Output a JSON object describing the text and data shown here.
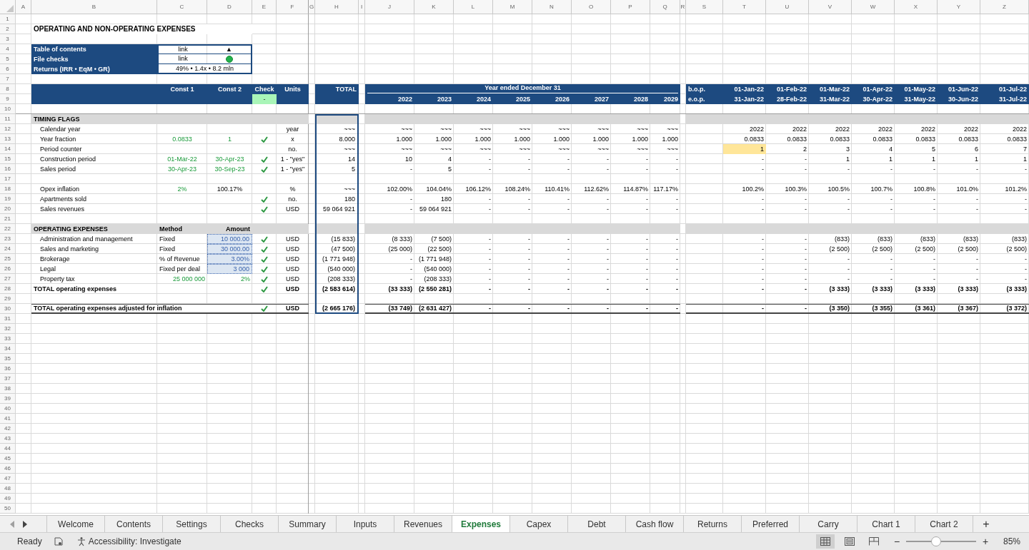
{
  "columns": [
    "A",
    "B",
    "C",
    "D",
    "E",
    "F",
    "G",
    "H",
    "I",
    "J",
    "K",
    "L",
    "M",
    "N",
    "O",
    "P",
    "Q",
    "R",
    "S",
    "T",
    "U",
    "V",
    "W",
    "X",
    "Y",
    "Z"
  ],
  "sheet": {
    "rows": [
      {
        "number": "1",
        "kind": "blank"
      },
      {
        "number": "2",
        "kind": "title",
        "label": "OPERATING AND NON-OPERATING EXPENSES"
      },
      {
        "number": "3",
        "kind": "blank"
      },
      {
        "number": "4",
        "kind": "nav",
        "label": "Table of contents",
        "col_c": {
          "text": "link",
          "kind": "link"
        },
        "col_d": {
          "text": "▲",
          "kind": "glyph"
        }
      },
      {
        "number": "5",
        "kind": "nav",
        "label": "File checks",
        "col_c": {
          "text": "link",
          "kind": "link"
        },
        "col_d": {
          "kind": "status-dot",
          "ok": true
        }
      },
      {
        "number": "6",
        "kind": "nav",
        "label": "Returns (IRR • EqM • GR)",
        "col_c": {
          "text": "49% • 1.4x • 8.2 mln",
          "kind": "plain",
          "merged": true
        }
      },
      {
        "number": "7",
        "kind": "blank"
      },
      {
        "number": "8",
        "kind": "header",
        "col_c": {
          "text": "Const 1",
          "kind": "heading"
        },
        "col_d": {
          "text": "Const 2",
          "kind": "heading"
        },
        "check": {
          "kind": "heading",
          "text": "Check"
        },
        "units": "Units",
        "total": "TOTAL",
        "years_title": "Year ended December 31",
        "period": "b.o.p.",
        "months": [
          "01-Jan-22",
          "01-Feb-22",
          "01-Mar-22",
          "01-Apr-22",
          "01-May-22",
          "01-Jun-22",
          "01-Jul-22"
        ]
      },
      {
        "number": "9",
        "kind": "header",
        "check": {
          "kind": "badge",
          "text": "-"
        },
        "years": [
          "2022",
          "2023",
          "2024",
          "2025",
          "2026",
          "2027",
          "2028",
          "2029"
        ],
        "period": "e.o.p.",
        "months": [
          "31-Jan-22",
          "28-Feb-22",
          "31-Mar-22",
          "30-Apr-22",
          "31-May-22",
          "30-Jun-22",
          "31-Jul-22"
        ]
      },
      {
        "number": "10",
        "kind": "blank"
      },
      {
        "number": "11",
        "kind": "section",
        "label": "TIMING FLAGS"
      },
      {
        "number": "12",
        "kind": "data",
        "label": "Calendar year",
        "units": "year",
        "total": "~~~",
        "years": [
          "~~~",
          "~~~",
          "~~~",
          "~~~",
          "~~~",
          "~~~",
          "~~~",
          "~~~"
        ],
        "months": [
          "2022",
          "2022",
          "2022",
          "2022",
          "2022",
          "2022",
          "2022"
        ]
      },
      {
        "number": "13",
        "kind": "data",
        "label": "Year fraction",
        "col_c": {
          "text": "0.0833",
          "kind": "input"
        },
        "col_d": {
          "text": "1",
          "kind": "input"
        },
        "check": {
          "kind": "tick",
          "ok": true
        },
        "units": "x",
        "total": "8.000",
        "years": [
          "1.000",
          "1.000",
          "1.000",
          "1.000",
          "1.000",
          "1.000",
          "1.000",
          "1.000"
        ],
        "months": [
          "0.0833",
          "0.0833",
          "0.0833",
          "0.0833",
          "0.0833",
          "0.0833",
          "0.0833"
        ]
      },
      {
        "number": "14",
        "kind": "data",
        "label": "Period counter",
        "units": "no.",
        "total": "~~~",
        "years": [
          "~~~",
          "~~~",
          "~~~",
          "~~~",
          "~~~",
          "~~~",
          "~~~",
          "~~~"
        ],
        "months": [
          {
            "text": "1",
            "highlighted": true
          },
          {
            "text": "2",
            "highlighted": false
          },
          {
            "text": "3",
            "highlighted": false
          },
          {
            "text": "4",
            "highlighted": false
          },
          {
            "text": "5",
            "highlighted": false
          },
          {
            "text": "6",
            "highlighted": false
          },
          {
            "text": "7",
            "highlighted": false
          }
        ]
      },
      {
        "number": "15",
        "kind": "data",
        "label": "Construction period",
        "col_c": {
          "text": "01-Mar-22",
          "kind": "input"
        },
        "col_d": {
          "text": "30-Apr-23",
          "kind": "input"
        },
        "check": {
          "kind": "tick",
          "ok": true
        },
        "units": "1 - \"yes\"",
        "total": "14",
        "years": [
          "10",
          "4",
          "-",
          "-",
          "-",
          "-",
          "-",
          "-"
        ],
        "months": [
          "-",
          "-",
          "1",
          "1",
          "1",
          "1",
          "1"
        ]
      },
      {
        "number": "16",
        "kind": "data",
        "label": "Sales period",
        "col_c": {
          "text": "30-Apr-23",
          "kind": "input"
        },
        "col_d": {
          "text": "30-Sep-23",
          "kind": "input"
        },
        "check": {
          "kind": "tick",
          "ok": true
        },
        "units": "1 - \"yes\"",
        "total": "5",
        "years": [
          "-",
          "5",
          "-",
          "-",
          "-",
          "-",
          "-",
          "-"
        ],
        "months": [
          "-",
          "-",
          "-",
          "-",
          "-",
          "-",
          "-"
        ]
      },
      {
        "number": "17",
        "kind": "blank"
      },
      {
        "number": "18",
        "kind": "data",
        "label": "Opex inflation",
        "col_c": {
          "text": "2%",
          "kind": "input"
        },
        "col_d": {
          "text": "100.17%",
          "kind": "plain"
        },
        "units": "%",
        "total": "~~~",
        "years": [
          "102.00%",
          "104.04%",
          "106.12%",
          "108.24%",
          "110.41%",
          "112.62%",
          "114.87%",
          "117.17%"
        ],
        "months": [
          "100.2%",
          "100.3%",
          "100.5%",
          "100.7%",
          "100.8%",
          "101.0%",
          "101.2%"
        ]
      },
      {
        "number": "19",
        "kind": "data",
        "label": "Apartments sold",
        "check": {
          "kind": "tick",
          "ok": true
        },
        "units": "no.",
        "total": "180",
        "years": [
          "-",
          "180",
          "-",
          "-",
          "-",
          "-",
          "-",
          "-"
        ],
        "months": [
          "-",
          "-",
          "-",
          "-",
          "-",
          "-",
          "-"
        ]
      },
      {
        "number": "20",
        "kind": "data",
        "label": "Sales revenues",
        "check": {
          "kind": "tick",
          "ok": true
        },
        "units": "USD",
        "total": "59 064 921",
        "years": [
          "-",
          "59 064 921",
          "-",
          "-",
          "-",
          "-",
          "-",
          "-"
        ],
        "months": [
          "-",
          "-",
          "-",
          "-",
          "-",
          "-",
          "-"
        ]
      },
      {
        "number": "21",
        "kind": "blank"
      },
      {
        "number": "22",
        "kind": "section",
        "label": "OPERATING EXPENSES",
        "col_c": {
          "text": "Method",
          "kind": "heading-left"
        },
        "col_d": {
          "text": "Amount",
          "kind": "heading-right"
        }
      },
      {
        "number": "23",
        "kind": "data",
        "label": "Administration and management",
        "col_c": {
          "text": "Fixed",
          "kind": "method"
        },
        "col_d": {
          "text": "10 000.00",
          "kind": "editable"
        },
        "check": {
          "kind": "tick",
          "ok": true
        },
        "units": "USD",
        "total": "(15 833)",
        "years": [
          "(8 333)",
          "(7 500)",
          "-",
          "-",
          "-",
          "-",
          "-",
          "-"
        ],
        "months": [
          "-",
          "-",
          "(833)",
          "(833)",
          "(833)",
          "(833)",
          "(833)"
        ]
      },
      {
        "number": "24",
        "kind": "data",
        "label": "Sales and marketing",
        "col_c": {
          "text": "Fixed",
          "kind": "method"
        },
        "col_d": {
          "text": "30 000.00",
          "kind": "editable"
        },
        "check": {
          "kind": "tick",
          "ok": true
        },
        "units": "USD",
        "total": "(47 500)",
        "years": [
          "(25 000)",
          "(22 500)",
          "-",
          "-",
          "-",
          "-",
          "-",
          "-"
        ],
        "months": [
          "-",
          "-",
          "(2 500)",
          "(2 500)",
          "(2 500)",
          "(2 500)",
          "(2 500)"
        ]
      },
      {
        "number": "25",
        "kind": "data",
        "label": "Brokerage",
        "col_c": {
          "text": "% of Revenue",
          "kind": "method"
        },
        "col_d": {
          "text": "3.00%",
          "kind": "editable"
        },
        "check": {
          "kind": "tick",
          "ok": true
        },
        "units": "USD",
        "total": "(1 771 948)",
        "years": [
          "-",
          "(1 771 948)",
          "-",
          "-",
          "-",
          "-",
          "-",
          "-"
        ],
        "months": [
          "-",
          "-",
          "-",
          "-",
          "-",
          "-",
          "-"
        ]
      },
      {
        "number": "26",
        "kind": "data",
        "label": "Legal",
        "col_c": {
          "text": "Fixed per deal",
          "kind": "method"
        },
        "col_d": {
          "text": "3 000",
          "kind": "editable"
        },
        "check": {
          "kind": "tick",
          "ok": true
        },
        "units": "USD",
        "total": "(540 000)",
        "years": [
          "-",
          "(540 000)",
          "-",
          "-",
          "-",
          "-",
          "-",
          "-"
        ],
        "months": [
          "-",
          "-",
          "-",
          "-",
          "-",
          "-",
          "-"
        ]
      },
      {
        "number": "27",
        "kind": "data",
        "label": "Property tax",
        "col_c": {
          "text": "25 000 000",
          "kind": "input-amount"
        },
        "col_d": {
          "text": "2%",
          "kind": "input-amount"
        },
        "check": {
          "kind": "tick",
          "ok": true
        },
        "units": "USD",
        "total": "(208 333)",
        "years": [
          "-",
          "(208 333)",
          "-",
          "-",
          "-",
          "-",
          "-",
          "-"
        ],
        "months": [
          "-",
          "-",
          "-",
          "-",
          "-",
          "-",
          "-"
        ]
      },
      {
        "number": "28",
        "kind": "total",
        "label": "TOTAL operating expenses",
        "check": {
          "kind": "tick",
          "ok": true
        },
        "units": "USD",
        "total": "(2 583 614)",
        "years": [
          "(33 333)",
          "(2 550 281)",
          "-",
          "-",
          "-",
          "-",
          "-",
          "-"
        ],
        "months": [
          "-",
          "-",
          "(3 333)",
          "(3 333)",
          "(3 333)",
          "(3 333)",
          "(3 333)"
        ]
      },
      {
        "number": "29",
        "kind": "blank"
      },
      {
        "number": "30",
        "kind": "grand-total",
        "label": "TOTAL operating expenses adjusted for inflation",
        "check": {
          "kind": "tick",
          "ok": true
        },
        "units": "USD",
        "total": "(2 665 176)",
        "years": [
          "(33 749)",
          "(2 631 427)",
          "-",
          "-",
          "-",
          "-",
          "-",
          "-"
        ],
        "months": [
          "-",
          "-",
          "(3 350)",
          "(3 355)",
          "(3 361)",
          "(3 367)",
          "(3 372)"
        ]
      },
      {
        "number": "31",
        "kind": "blank"
      },
      {
        "number": "32",
        "kind": "blank"
      },
      {
        "number": "33",
        "kind": "blank"
      },
      {
        "number": "34",
        "kind": "blank"
      },
      {
        "number": "35",
        "kind": "blank"
      },
      {
        "number": "36",
        "kind": "blank"
      },
      {
        "number": "37",
        "kind": "blank"
      },
      {
        "number": "38",
        "kind": "blank"
      },
      {
        "number": "39",
        "kind": "blank"
      },
      {
        "number": "40",
        "kind": "blank"
      },
      {
        "number": "41",
        "kind": "blank"
      },
      {
        "number": "42",
        "kind": "blank"
      },
      {
        "number": "43",
        "kind": "blank"
      },
      {
        "number": "44",
        "kind": "blank"
      },
      {
        "number": "45",
        "kind": "blank"
      },
      {
        "number": "46",
        "kind": "blank"
      },
      {
        "number": "47",
        "kind": "blank"
      },
      {
        "number": "48",
        "kind": "blank"
      },
      {
        "number": "49",
        "kind": "blank"
      },
      {
        "number": "50",
        "kind": "blank"
      }
    ]
  },
  "sheet_tabs": [
    {
      "label": "Welcome",
      "selected": false
    },
    {
      "label": "Contents",
      "selected": false
    },
    {
      "label": "Settings",
      "selected": false
    },
    {
      "label": "Checks",
      "selected": false
    },
    {
      "label": "Summary",
      "selected": false
    },
    {
      "label": "Inputs",
      "selected": false
    },
    {
      "label": "Revenues",
      "selected": false
    },
    {
      "label": "Expenses",
      "selected": true
    },
    {
      "label": "Capex",
      "selected": false
    },
    {
      "label": "Debt",
      "selected": false
    },
    {
      "label": "Cash flow",
      "selected": false
    },
    {
      "label": "Returns",
      "selected": false
    },
    {
      "label": "Preferred",
      "selected": false
    },
    {
      "label": "Carry",
      "selected": false
    },
    {
      "label": "Chart 1",
      "selected": false
    },
    {
      "label": "Chart 2",
      "selected": false
    }
  ],
  "add_sheet": "+",
  "status_bar": {
    "status": "Ready",
    "accessibility": "Accessibility: Investigate",
    "views": [
      {
        "kind": "normal",
        "selected": true
      },
      {
        "kind": "page-layout",
        "selected": false
      },
      {
        "kind": "page-break",
        "selected": false
      }
    ],
    "zoom_out": "−",
    "zoom_slider": {
      "level": 0.43
    },
    "zoom_in": "+",
    "zoom": "85%"
  }
}
